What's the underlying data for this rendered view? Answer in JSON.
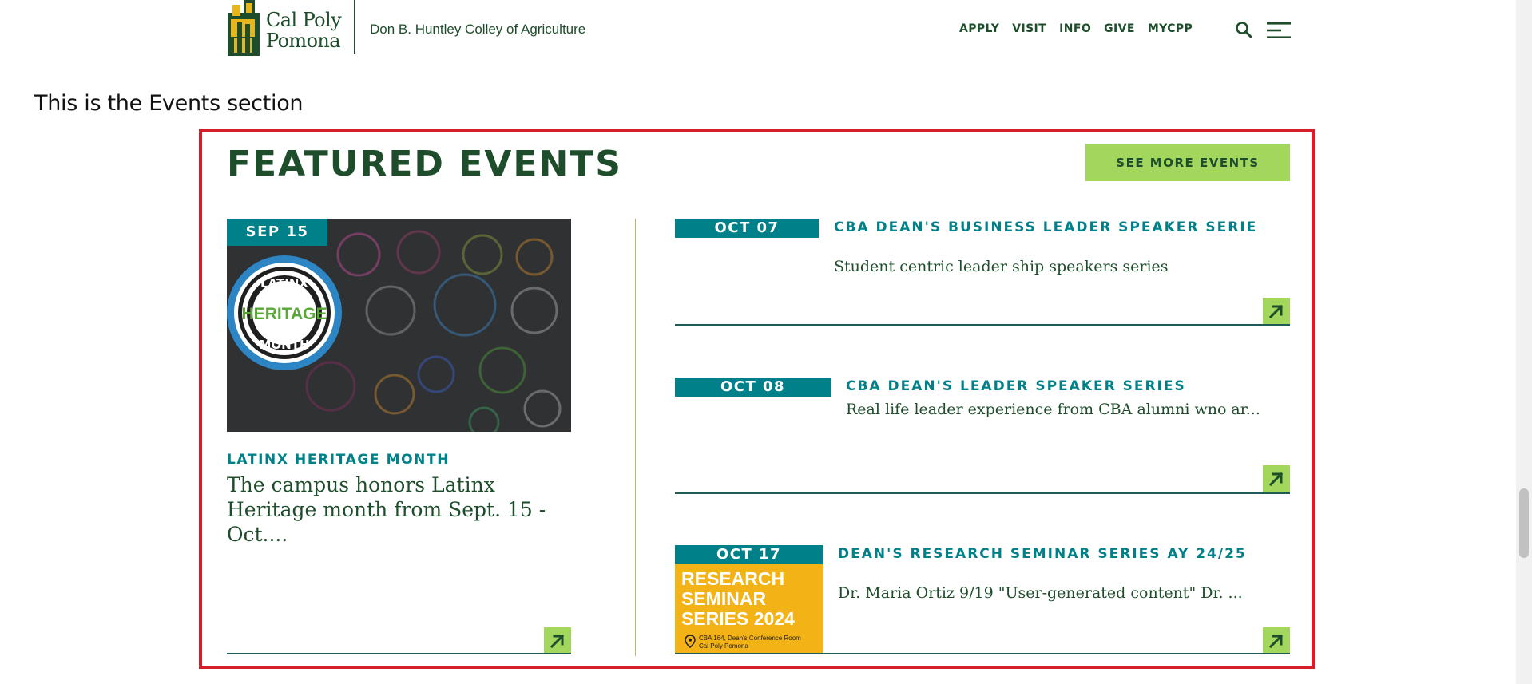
{
  "header": {
    "logo": {
      "line1": "Cal Poly",
      "line2": "Pomona"
    },
    "college_name": "Don B. Huntley Colley of Agriculture",
    "nav": [
      "APPLY",
      "VISIT",
      "INFO",
      "GIVE",
      "MYCPP"
    ],
    "search_icon": "search-icon",
    "menu_icon": "hamburger-menu-icon"
  },
  "caption": "This is the Events section",
  "events": {
    "title": "FEATURED EVENTS",
    "see_more_label": "SEE MORE EVENTS",
    "featured": {
      "date": "SEP 15",
      "image_labels": {
        "top": "LATINX",
        "middle": "HERITAGE",
        "bottom": "MONTH"
      },
      "kicker": "LATINX HERITAGE MONTH",
      "description": "The campus honors Latinx Heritage month from Sept. 15 - Oct...."
    },
    "items": [
      {
        "date": "OCT 07",
        "title": "CBA DEAN'S BUSINESS LEADER SPEAKER SERIE",
        "description": "Student centric leader ship speakers series"
      },
      {
        "date": "OCT 08",
        "title": "CBA DEAN'S LEADER SPEAKER SERIES",
        "description": "Real life leader experience from CBA alumni wno ar..."
      },
      {
        "date": "OCT 17",
        "title": "DEAN'S RESEARCH SEMINAR SERIES AY 24/25",
        "description": "Dr. Maria Ortiz 9/19 \"User-generated content\" Dr. ...",
        "thumb_title": "RESEARCH SEMINAR SERIES 2024",
        "thumb_location": "CBA 164, Dean's Conference Room Cal Poly Pomona"
      }
    ]
  },
  "colors": {
    "brand_green": "#1e4d2b",
    "teal": "#00818a",
    "lime": "#a3d65c",
    "gold": "#f3b317",
    "highlight_red": "#d41f2a"
  }
}
